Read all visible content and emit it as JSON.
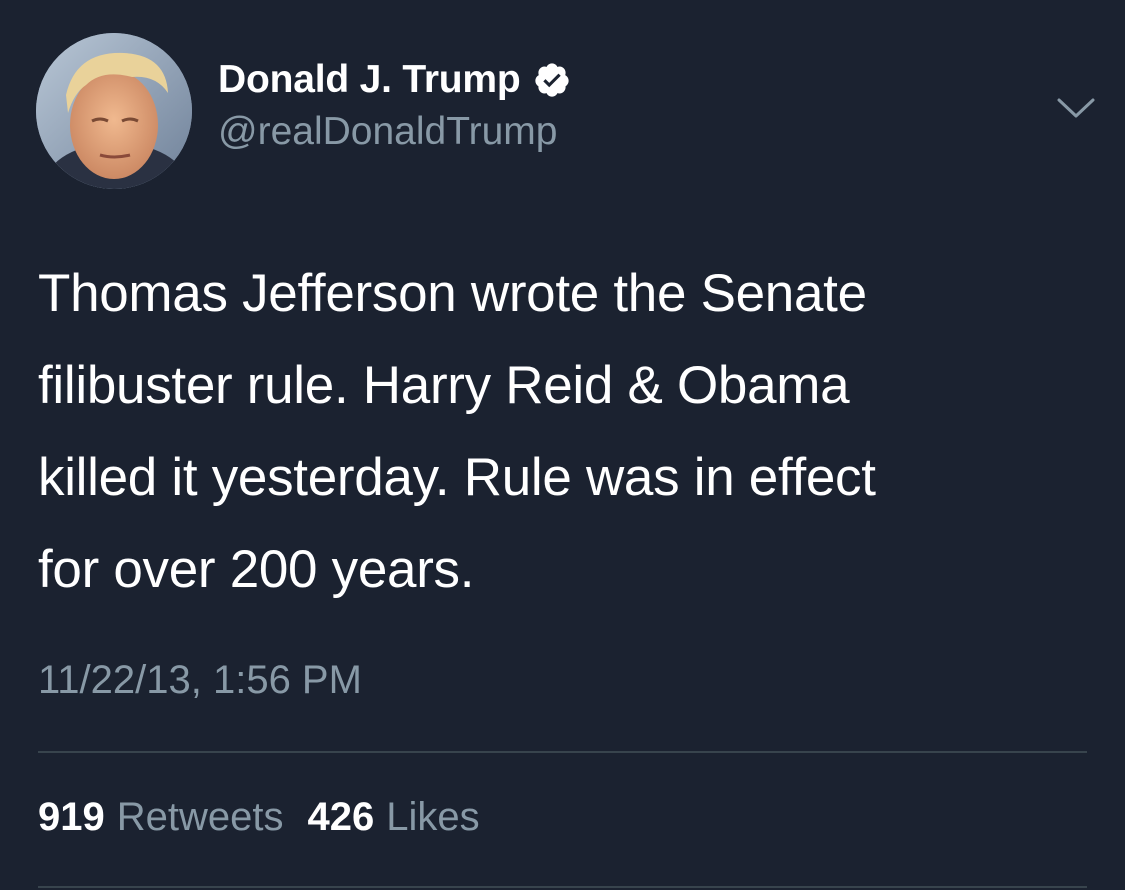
{
  "author": {
    "display_name": "Donald J. Trump",
    "handle": "@realDonaldTrump",
    "verified": true,
    "avatar_icon": "profile-photo"
  },
  "tweet": {
    "text": "Thomas Jefferson wrote the Senate\nfilibuster rule. Harry Reid & Obama\nkilled it yesterday.  Rule was in effect\nfor over 200 years.",
    "timestamp": "11/22/13, 1:56 PM"
  },
  "stats": {
    "retweets_count": "919",
    "retweets_label": "Retweets",
    "likes_count": "426",
    "likes_label": "Likes"
  },
  "icons": {
    "verified": "verified-badge-icon",
    "menu": "chevron-down-icon"
  },
  "colors": {
    "background": "#1b2230",
    "primary_text": "#ffffff",
    "secondary_text": "#8899a6",
    "divider": "#38444d"
  }
}
